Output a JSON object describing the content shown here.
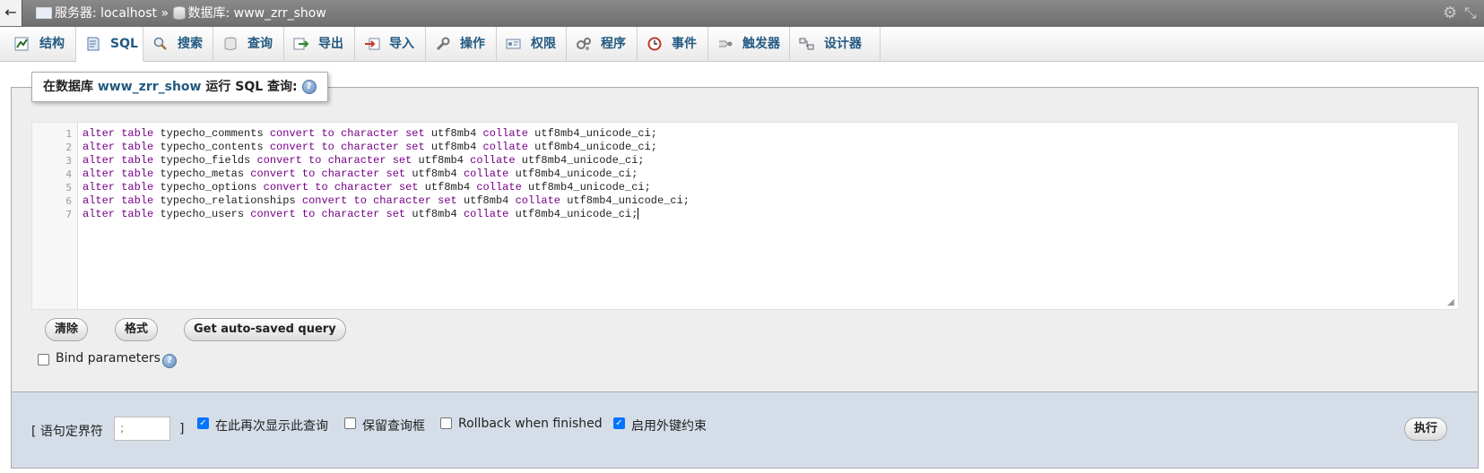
{
  "topbar": {
    "server_label": "服务器: localhost",
    "separator": "»",
    "db_label": "数据库: www_zrr_show",
    "icons": [
      "back-arrow-icon",
      "server-icon",
      "database-icon",
      "gear-icon",
      "collapse-icon"
    ]
  },
  "tabs": [
    {
      "label": "结构",
      "icon": "structure-icon"
    },
    {
      "label": "SQL",
      "icon": "sql-icon",
      "active": true
    },
    {
      "label": "搜索",
      "icon": "search-icon"
    },
    {
      "label": "查询",
      "icon": "query-icon"
    },
    {
      "label": "导出",
      "icon": "export-icon"
    },
    {
      "label": "导入",
      "icon": "import-icon"
    },
    {
      "label": "操作",
      "icon": "wrench-icon"
    },
    {
      "label": "权限",
      "icon": "privileges-icon"
    },
    {
      "label": "程序",
      "icon": "routines-icon"
    },
    {
      "label": "事件",
      "icon": "clock-icon"
    },
    {
      "label": "触发器",
      "icon": "triggers-icon"
    },
    {
      "label": "设计器",
      "icon": "designer-icon"
    }
  ],
  "sql_panel": {
    "legend_prefix": "在数据库",
    "legend_db": "www_zrr_show",
    "legend_suffix": "运行 SQL 查询:",
    "line_numbers": [
      "1",
      "2",
      "3",
      "4",
      "5",
      "6",
      "7"
    ],
    "lines": [
      {
        "table": "typecho_comments"
      },
      {
        "table": "typecho_contents"
      },
      {
        "table": "typecho_fields"
      },
      {
        "table": "typecho_metas"
      },
      {
        "table": "typecho_options"
      },
      {
        "table": "typecho_relationships"
      },
      {
        "table": "typecho_users"
      }
    ],
    "kw_alter": "alter",
    "kw_table": "table",
    "kw_convert": "convert",
    "kw_to": "to",
    "kw_character": "character",
    "kw_set": "set",
    "charset": "utf8mb4",
    "kw_collate": "collate",
    "collation": "utf8mb4_unicode_ci;",
    "buttons": {
      "clear": "清除",
      "format": "格式",
      "autosaved": "Get auto-saved query"
    },
    "bind_params_label": "Bind parameters",
    "bind_params_checked": false
  },
  "bottom": {
    "delimiter_label_open": "[ 语句定界符",
    "delimiter_value": ";",
    "delimiter_label_close": "]",
    "show_query_label": "在此再次显示此查询",
    "show_query_checked": true,
    "retain_box_label": "保留查询框",
    "retain_box_checked": false,
    "rollback_label": "Rollback when finished",
    "rollback_checked": false,
    "fk_label": "启用外键约束",
    "fk_checked": true,
    "go_button": "执行"
  }
}
